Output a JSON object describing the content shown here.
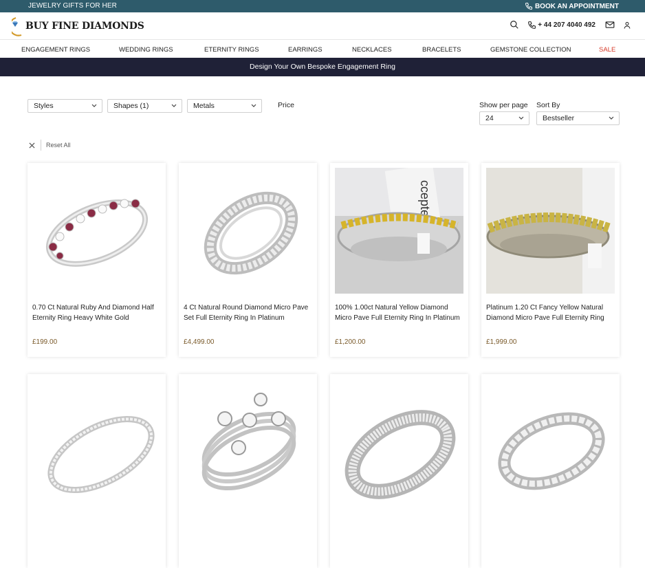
{
  "topbar": {
    "left_text": "JEWELRY GIFTS FOR HER",
    "appointment": "BOOK AN APPOINTMENT",
    "bg_color": "#2e5b6b"
  },
  "header": {
    "logo_text": "BUY FINE DIAMONDS",
    "phone": "+ 44 207 4040 492",
    "icons": [
      "search-icon",
      "phone-icon",
      "mail-icon",
      "user-icon"
    ]
  },
  "nav": {
    "items": [
      {
        "label": "ENGAGEMENT RINGS"
      },
      {
        "label": "WEDDING RINGS"
      },
      {
        "label": "ETERNITY RINGS"
      },
      {
        "label": "EARRINGS"
      },
      {
        "label": "NECKLACES"
      },
      {
        "label": "BRACELETS"
      },
      {
        "label": "GEMSTONE COLLECTION"
      },
      {
        "label": "SALE"
      }
    ],
    "sale_color": "#d73b2a"
  },
  "banner": {
    "text": "Design Your Own Bespoke Engagement Ring",
    "bg_color": "#1f2137"
  },
  "filters": {
    "styles": "Styles",
    "shapes": "Shapes (1)",
    "metals": "Metals",
    "price": "Price",
    "per_page_label": "Show per page",
    "per_page_value": "24",
    "sort_label": "Sort By",
    "sort_value": "Bestseller",
    "reset": "Reset All"
  },
  "products": [
    {
      "title": "0.70 Ct Natural Ruby And Diamond Half Eternity Ring Heavy White Gold",
      "price": "£199.00"
    },
    {
      "title": "4 Ct Natural Round Diamond Micro Pave Set Full Eternity Ring In Platinum",
      "price": "£4,499.00"
    },
    {
      "title": "100% 1.00ct Natural Yellow Diamond Micro Pave Full Eternity Ring In Platinum",
      "price": "£1,200.00"
    },
    {
      "title": "Platinum 1.20 Ct Fancy Yellow Natural Diamond Micro Pave Full Eternity Ring",
      "price": "£1,999.00"
    },
    {
      "title": "",
      "price": ""
    },
    {
      "title": "",
      "price": ""
    },
    {
      "title": "",
      "price": ""
    },
    {
      "title": "",
      "price": ""
    }
  ]
}
